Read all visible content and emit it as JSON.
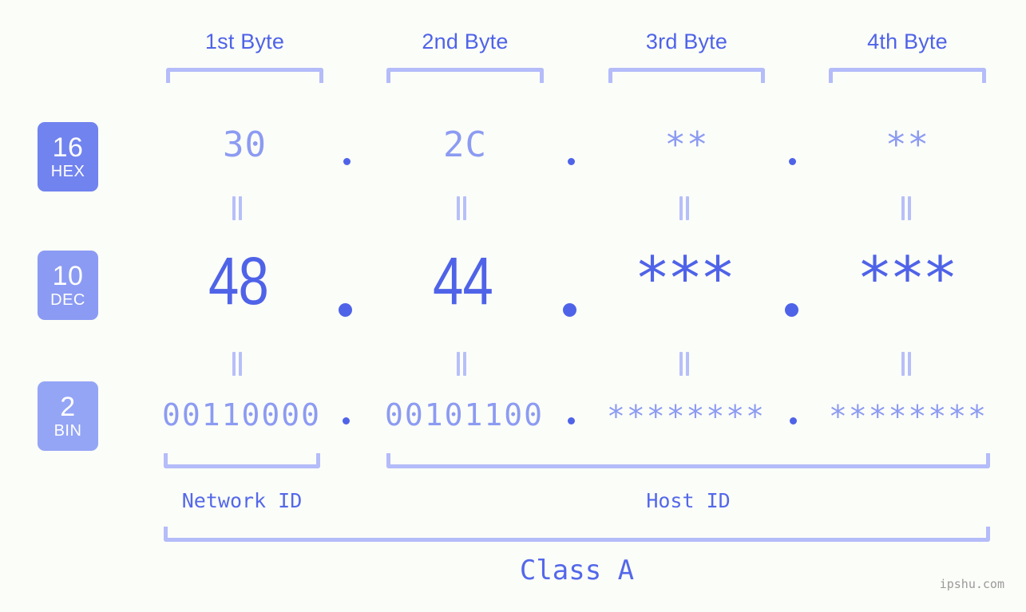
{
  "background_color": "#fbfdf8",
  "accent_color": "#4f63e8",
  "muted_color": "#8c9bf2",
  "bracket_color": "#b4bcf9",
  "headers": [
    {
      "label": "1st Byte"
    },
    {
      "label": "2nd Byte"
    },
    {
      "label": "3rd Byte"
    },
    {
      "label": "4th Byte"
    }
  ],
  "bases": [
    {
      "number": "16",
      "name": "HEX",
      "color": "#7183ee"
    },
    {
      "number": "10",
      "name": "DEC",
      "color": "#8b9bf3"
    },
    {
      "number": "2",
      "name": "BIN",
      "color": "#94a5f6"
    }
  ],
  "rows": {
    "hex": {
      "values": [
        "30",
        "2C",
        "**",
        "**"
      ]
    },
    "dec": {
      "values": [
        "48",
        "44",
        "***",
        "***"
      ]
    },
    "bin": {
      "values": [
        "00110000",
        "00101100",
        "********",
        "********"
      ]
    }
  },
  "separator": ".",
  "equals_mark": "||",
  "footer": {
    "network_id_label": "Network ID",
    "host_id_label": "Host ID",
    "class_label": "Class A"
  },
  "watermark": "ipshu.com"
}
